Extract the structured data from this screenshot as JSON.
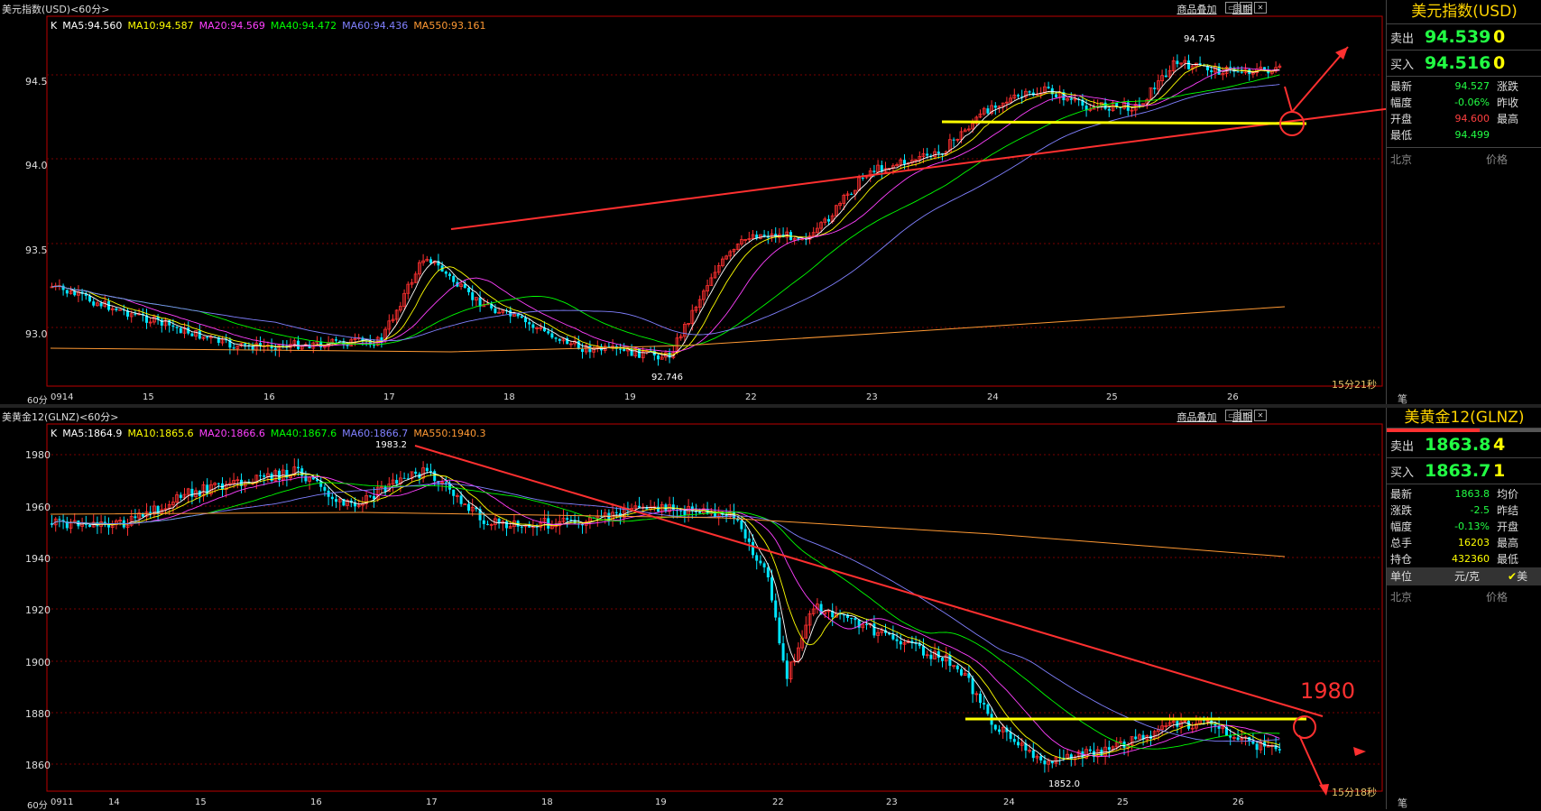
{
  "top": {
    "title": "美元指数(USD)<60分>",
    "links": [
      "商品叠加",
      "周期"
    ],
    "ma_legend": [
      {
        "text": "K",
        "color": "#ffffff"
      },
      {
        "text": "MA5:94.560",
        "color": "#ffffff"
      },
      {
        "text": "MA10:94.587",
        "color": "#ffff00"
      },
      {
        "text": "MA20:94.569",
        "color": "#ff40ff"
      },
      {
        "text": "MA40:94.472",
        "color": "#00ff00"
      },
      {
        "text": "MA60:94.436",
        "color": "#8080ff"
      },
      {
        "text": "MA550:93.161",
        "color": "#ff9933"
      }
    ],
    "y_ticks": [
      "94.5",
      "94.0",
      "93.5",
      "93.0"
    ],
    "x_ticks": [
      "60分",
      "0914",
      "15",
      "16",
      "17",
      "18",
      "19",
      "22",
      "23",
      "24",
      "25",
      "26"
    ],
    "annotations": {
      "high": "94.745",
      "low": "92.746"
    },
    "timer": "15分21秒",
    "side": {
      "title": "美元指数(USD)",
      "sell_label": "卖出",
      "sell_price": "94.539",
      "sell_qty": "0",
      "buy_label": "买入",
      "buy_price": "94.516",
      "buy_qty": "0",
      "rows": [
        {
          "k": "最新",
          "v": "94.527",
          "k2": "涨跌",
          "color": "#22ff44"
        },
        {
          "k": "幅度",
          "v": "-0.06%",
          "k2": "昨收",
          "color": "#22ff44"
        },
        {
          "k": "开盘",
          "v": "94.600",
          "k2": "最高",
          "color": "#ff4040"
        },
        {
          "k": "最低",
          "v": "94.499",
          "k2": "",
          "color": "#22ff44"
        }
      ],
      "loc": "北京",
      "price_label": "价格",
      "bottom": "笔"
    }
  },
  "bottom": {
    "title": "美黄金12(GLNZ)<60分>",
    "links": [
      "商品叠加",
      "周期"
    ],
    "ma_legend": [
      {
        "text": "K",
        "color": "#ffffff"
      },
      {
        "text": "MA5:1864.9",
        "color": "#ffffff"
      },
      {
        "text": "MA10:1865.6",
        "color": "#ffff00"
      },
      {
        "text": "MA20:1866.6",
        "color": "#ff40ff"
      },
      {
        "text": "MA40:1867.6",
        "color": "#00ff00"
      },
      {
        "text": "MA60:1866.7",
        "color": "#8080ff"
      },
      {
        "text": "MA550:1940.3",
        "color": "#ff9933"
      }
    ],
    "y_ticks": [
      "1980",
      "1960",
      "1940",
      "1920",
      "1900",
      "1880",
      "1860"
    ],
    "x_ticks": [
      "60分",
      "0911",
      "14",
      "15",
      "16",
      "17",
      "18",
      "19",
      "22",
      "23",
      "24",
      "25",
      "26"
    ],
    "annotations": {
      "high": "1983.2",
      "low": "1852.0",
      "target": "1980"
    },
    "timer": "15分18秒",
    "side": {
      "title": "美黄金12(GLNZ)",
      "sell_label": "卖出",
      "sell_price": "1863.8",
      "sell_qty": "4",
      "buy_label": "买入",
      "buy_price": "1863.7",
      "buy_qty": "1",
      "rows": [
        {
          "k": "最新",
          "v": "1863.8",
          "k2": "均价",
          "color": "#22ff44"
        },
        {
          "k": "涨跌",
          "v": "-2.5",
          "k2": "昨结",
          "color": "#22ff44"
        },
        {
          "k": "幅度",
          "v": "-0.13%",
          "k2": "开盘",
          "color": "#22ff44"
        },
        {
          "k": "总手",
          "v": "16203",
          "k2": "最高",
          "color": "#ffff00"
        },
        {
          "k": "持仓",
          "v": "432360",
          "k2": "最低",
          "color": "#ffff00"
        }
      ],
      "unit_label": "单位",
      "unit_value": "元/克",
      "unit_check": "美",
      "loc": "北京",
      "price_label": "价格",
      "bottom": "笔"
    }
  }
}
